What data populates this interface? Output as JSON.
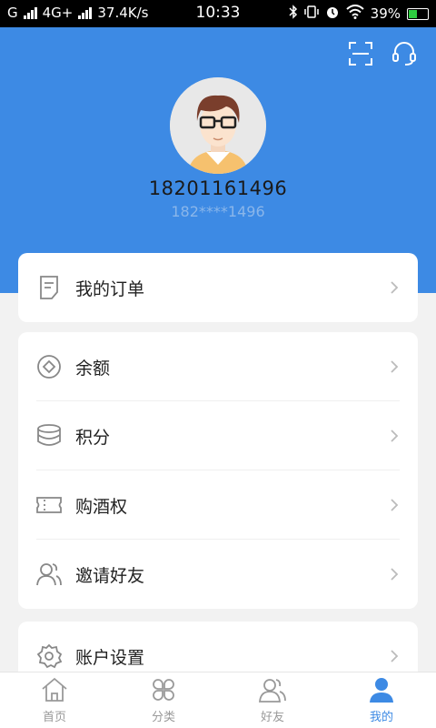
{
  "status_bar": {
    "carrier": "G",
    "network": "4G+",
    "speed": "37.4K/s",
    "time": "10:33",
    "battery_percent": "39%",
    "battery_level": 0.39
  },
  "profile": {
    "phone_full": "18201161496",
    "phone_masked": "182****1496"
  },
  "orders": {
    "label": "我的订单"
  },
  "wallet_items": [
    {
      "label": "余额",
      "icon": "coin-icon"
    },
    {
      "label": "积分",
      "icon": "points-stack-icon"
    },
    {
      "label": "购酒权",
      "icon": "ticket-icon"
    },
    {
      "label": "邀请好友",
      "icon": "invite-friends-icon"
    }
  ],
  "settings": {
    "label": "账户设置"
  },
  "tabs": [
    {
      "label": "首页",
      "icon": "home-icon",
      "active": false
    },
    {
      "label": "分类",
      "icon": "category-icon",
      "active": false
    },
    {
      "label": "好友",
      "icon": "friends-icon",
      "active": false
    },
    {
      "label": "我的",
      "icon": "profile-icon",
      "active": true
    }
  ],
  "colors": {
    "accent": "#3d8ae4",
    "inactive": "#999999"
  }
}
